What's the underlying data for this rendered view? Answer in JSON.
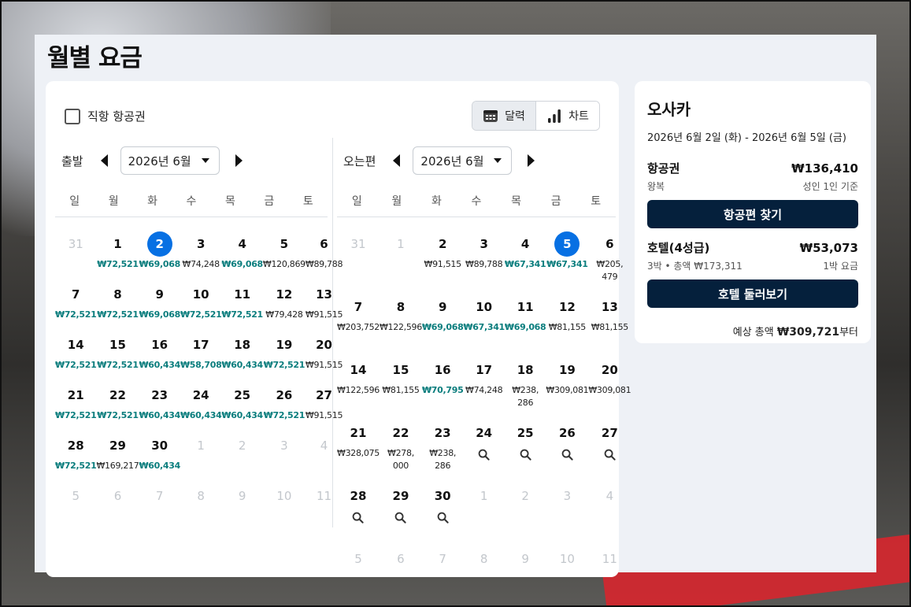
{
  "page": {
    "title": "월별 요금"
  },
  "filters": {
    "direct_label": "직항 항공권"
  },
  "view_toggle": {
    "calendar_label": "달력",
    "chart_label": "차트",
    "calendar_icon": "calendar-icon",
    "chart_icon": "bar-chart-icon"
  },
  "weekdays": [
    "일",
    "월",
    "화",
    "수",
    "목",
    "금",
    "토"
  ],
  "depart": {
    "label": "출발",
    "month": "2026년 6월",
    "days": [
      {
        "d": "31",
        "m": true
      },
      {
        "d": "1",
        "p": "₩72,521",
        "low": true
      },
      {
        "d": "2",
        "p": "₩69,068",
        "low": true,
        "sel": true
      },
      {
        "d": "3",
        "p": "₩74,248"
      },
      {
        "d": "4",
        "p": "₩69,068",
        "low": true
      },
      {
        "d": "5",
        "p": "₩120,869"
      },
      {
        "d": "6",
        "p": "₩89,788"
      },
      {
        "d": "7",
        "p": "₩72,521",
        "low": true
      },
      {
        "d": "8",
        "p": "₩72,521",
        "low": true
      },
      {
        "d": "9",
        "p": "₩69,068",
        "low": true
      },
      {
        "d": "10",
        "p": "₩72,521",
        "low": true
      },
      {
        "d": "11",
        "p": "₩72,521",
        "low": true
      },
      {
        "d": "12",
        "p": "₩79,428"
      },
      {
        "d": "13",
        "p": "₩91,515"
      },
      {
        "d": "14",
        "p": "₩72,521",
        "low": true
      },
      {
        "d": "15",
        "p": "₩72,521",
        "low": true
      },
      {
        "d": "16",
        "p": "₩60,434",
        "low": true
      },
      {
        "d": "17",
        "p": "₩58,708",
        "low": true
      },
      {
        "d": "18",
        "p": "₩60,434",
        "low": true
      },
      {
        "d": "19",
        "p": "₩72,521",
        "low": true
      },
      {
        "d": "20",
        "p": "₩91,515"
      },
      {
        "d": "21",
        "p": "₩72,521",
        "low": true
      },
      {
        "d": "22",
        "p": "₩72,521",
        "low": true
      },
      {
        "d": "23",
        "p": "₩60,434",
        "low": true
      },
      {
        "d": "24",
        "p": "₩60,434",
        "low": true
      },
      {
        "d": "25",
        "p": "₩60,434",
        "low": true
      },
      {
        "d": "26",
        "p": "₩72,521",
        "low": true
      },
      {
        "d": "27",
        "p": "₩91,515"
      },
      {
        "d": "28",
        "p": "₩72,521",
        "low": true
      },
      {
        "d": "29",
        "p": "₩169,217"
      },
      {
        "d": "30",
        "p": "₩60,434",
        "low": true
      },
      {
        "d": "1",
        "m": true
      },
      {
        "d": "2",
        "m": true
      },
      {
        "d": "3",
        "m": true
      },
      {
        "d": "4",
        "m": true
      },
      {
        "d": "5",
        "m": true
      },
      {
        "d": "6",
        "m": true
      },
      {
        "d": "7",
        "m": true
      },
      {
        "d": "8",
        "m": true
      },
      {
        "d": "9",
        "m": true
      },
      {
        "d": "10",
        "m": true
      },
      {
        "d": "11",
        "m": true
      }
    ]
  },
  "return": {
    "label": "오는편",
    "month": "2026년 6월",
    "weeks": [
      [
        {
          "d": "31",
          "m": true
        },
        {
          "d": "1",
          "m": true
        },
        {
          "d": "2",
          "p": "₩91,515"
        },
        {
          "d": "3",
          "p": "₩89,788"
        },
        {
          "d": "4",
          "p": "₩67,341",
          "low": true
        },
        {
          "d": "5",
          "p": "₩67,341",
          "low": true,
          "sel": true
        },
        {
          "d": "6",
          "p": "₩205,\n479"
        }
      ],
      [
        {
          "d": "7",
          "p": "₩203,752"
        },
        {
          "d": "8",
          "p": "₩122,596"
        },
        {
          "d": "9",
          "p": "₩69,068",
          "low": true
        },
        {
          "d": "10",
          "p": "₩67,341",
          "low": true
        },
        {
          "d": "11",
          "p": "₩69,068",
          "low": true
        },
        {
          "d": "12",
          "p": "₩81,155"
        },
        {
          "d": "13",
          "p": "₩81,155"
        }
      ],
      [
        {
          "d": "14",
          "p": "₩122,596"
        },
        {
          "d": "15",
          "p": "₩81,155"
        },
        {
          "d": "16",
          "p": "₩70,795",
          "low": true
        },
        {
          "d": "17",
          "p": "₩74,248"
        },
        {
          "d": "18",
          "p": "₩238,\n286"
        },
        {
          "d": "19",
          "p": "₩309,081"
        },
        {
          "d": "20",
          "p": "₩309,081"
        }
      ],
      [
        {
          "d": "21",
          "p": "₩328,075"
        },
        {
          "d": "22",
          "p": "₩278,\n000"
        },
        {
          "d": "23",
          "p": "₩238,\n286"
        },
        {
          "d": "24",
          "s": true
        },
        {
          "d": "25",
          "s": true
        },
        {
          "d": "26",
          "s": true
        },
        {
          "d": "27",
          "s": true
        }
      ],
      [
        {
          "d": "28",
          "s": true
        },
        {
          "d": "29",
          "s": true
        },
        {
          "d": "30",
          "s": true
        },
        {
          "d": "1",
          "m": true
        },
        {
          "d": "2",
          "m": true
        },
        {
          "d": "3",
          "m": true
        },
        {
          "d": "4",
          "m": true
        }
      ],
      [
        {
          "d": "5",
          "m": true
        },
        {
          "d": "6",
          "m": true
        },
        {
          "d": "7",
          "m": true
        },
        {
          "d": "8",
          "m": true
        },
        {
          "d": "9",
          "m": true
        },
        {
          "d": "10",
          "m": true
        },
        {
          "d": "11",
          "m": true
        }
      ]
    ]
  },
  "summary": {
    "city": "오사카",
    "dates": "2026년 6월 2일 (화) - 2026년 6월 5일 (금)",
    "flight_label": "항공권",
    "flight_price": "₩136,410",
    "flight_sub_left": "왕복",
    "flight_sub_right": "성인 1인 기준",
    "flight_button": "항공편 찾기",
    "hotel_label": "호텔(4성급)",
    "hotel_price": "₩53,073",
    "hotel_sub_left": "3박 • 총액 ₩173,311",
    "hotel_sub_right": "1박 요금",
    "hotel_button": "호텔 둘러보기",
    "total_prefix": "예상 총액 ",
    "total_value": "₩309,721",
    "total_suffix": "부터"
  },
  "colors": {
    "selected": "#0770e3",
    "low_price": "#0a7d7d",
    "button_dark": "#05203c"
  }
}
